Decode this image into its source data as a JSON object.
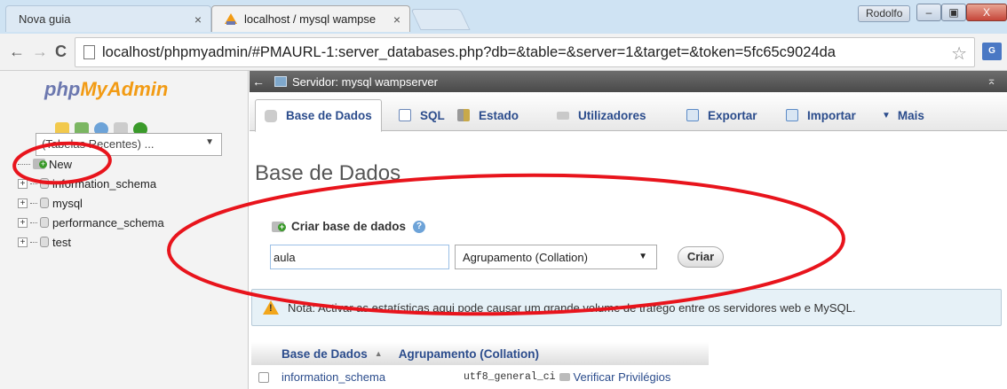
{
  "browser": {
    "tabs": [
      {
        "label": "Nova guia",
        "close": "×"
      },
      {
        "label": "localhost / mysql wampse",
        "close": "×"
      }
    ],
    "user_button": "Rodolfo",
    "window_controls": {
      "minimize": "–",
      "maximize": "▣",
      "close": "X"
    },
    "nav": {
      "back": "←",
      "forward": "→",
      "reload": "C"
    },
    "url": "localhost/phpmyadmin/#PMAURL-1:server_databases.php?db=&table=&server=1&target=&token=5fc65c9024da",
    "star": "☆",
    "extension_label": "G"
  },
  "sidebar": {
    "logo_part1": "php",
    "logo_part2": "MyAdmin",
    "recent_select": "(Tabelas Recentes) ...",
    "select_arrow": "▼",
    "tree": [
      {
        "label": "New"
      },
      {
        "label": "information_schema",
        "expander": "+"
      },
      {
        "label": "mysql",
        "expander": "+"
      },
      {
        "label": "performance_schema",
        "expander": "+"
      },
      {
        "label": "test",
        "expander": "+"
      }
    ]
  },
  "server_bar": {
    "back": "←",
    "title": "Servidor: mysql wampserver",
    "collapse": "⌅"
  },
  "menu": {
    "items": [
      {
        "label": "Base de Dados"
      },
      {
        "label": "SQL"
      },
      {
        "label": "Estado"
      },
      {
        "label": "Utilizadores"
      },
      {
        "label": "Exportar"
      },
      {
        "label": "Importar"
      },
      {
        "label": "Mais",
        "arrow": "▼"
      }
    ]
  },
  "main": {
    "title": "Base de Dados",
    "create": {
      "label": "Criar base de dados",
      "help": "?",
      "name_value": "aula",
      "collation_placeholder": "Agrupamento (Collation)",
      "select_arrow": "▼",
      "button": "Criar"
    },
    "notice": {
      "icon_glyph": "!",
      "text": "Nota: Activar as estatísticas aqui pode causar um grande volume de tráfego entre os servidores web e MySQL."
    },
    "table": {
      "headers": {
        "name": "Base de Dados",
        "sort": "▲",
        "collation": "Agrupamento (Collation)"
      },
      "rows": [
        {
          "name": "information_schema",
          "collation": "utf8_general_ci",
          "action": "Verificar Privilégios"
        }
      ]
    }
  },
  "colors": {
    "annotation": "#e8141c",
    "link": "#2b4c8c",
    "logo_blue": "#6c78af",
    "logo_orange": "#f29b14"
  }
}
